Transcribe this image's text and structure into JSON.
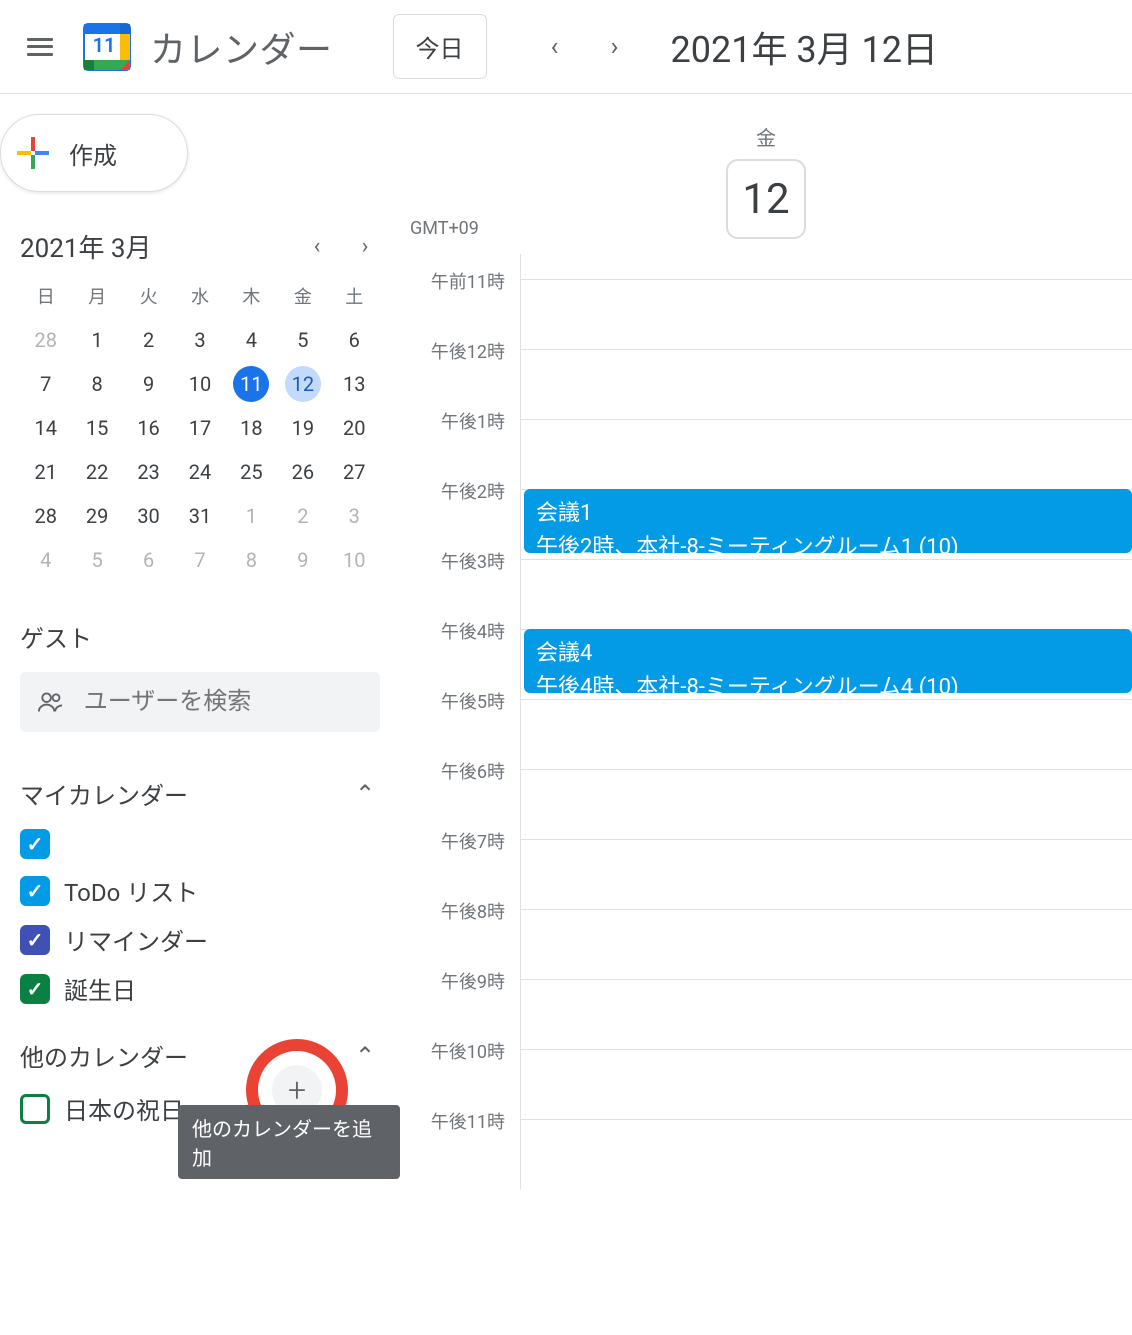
{
  "header": {
    "app_title": "カレンダー",
    "logo_number": "11",
    "today_label": "今日",
    "date_label": "2021年 3月 12日"
  },
  "create": {
    "label": "作成"
  },
  "minical": {
    "title": "2021年 3月",
    "dow": [
      "日",
      "月",
      "火",
      "水",
      "木",
      "金",
      "土"
    ],
    "weeks": [
      [
        {
          "d": "28",
          "off": true
        },
        {
          "d": "1"
        },
        {
          "d": "2"
        },
        {
          "d": "3"
        },
        {
          "d": "4"
        },
        {
          "d": "5"
        },
        {
          "d": "6"
        }
      ],
      [
        {
          "d": "7"
        },
        {
          "d": "8"
        },
        {
          "d": "9"
        },
        {
          "d": "10"
        },
        {
          "d": "11",
          "today": true
        },
        {
          "d": "12",
          "selected": true
        },
        {
          "d": "13"
        }
      ],
      [
        {
          "d": "14"
        },
        {
          "d": "15"
        },
        {
          "d": "16"
        },
        {
          "d": "17"
        },
        {
          "d": "18"
        },
        {
          "d": "19"
        },
        {
          "d": "20"
        }
      ],
      [
        {
          "d": "21"
        },
        {
          "d": "22"
        },
        {
          "d": "23"
        },
        {
          "d": "24"
        },
        {
          "d": "25"
        },
        {
          "d": "26"
        },
        {
          "d": "27"
        }
      ],
      [
        {
          "d": "28"
        },
        {
          "d": "29"
        },
        {
          "d": "30"
        },
        {
          "d": "31"
        },
        {
          "d": "1",
          "off": true
        },
        {
          "d": "2",
          "off": true
        },
        {
          "d": "3",
          "off": true
        }
      ],
      [
        {
          "d": "4",
          "off": true
        },
        {
          "d": "5",
          "off": true
        },
        {
          "d": "6",
          "off": true
        },
        {
          "d": "7",
          "off": true
        },
        {
          "d": "8",
          "off": true
        },
        {
          "d": "9",
          "off": true
        },
        {
          "d": "10",
          "off": true
        }
      ]
    ]
  },
  "guests": {
    "title": "ゲスト",
    "placeholder": "ユーザーを検索"
  },
  "my_calendars": {
    "title": "マイカレンダー",
    "items": [
      {
        "label": "",
        "color": "#039be5",
        "checked": true
      },
      {
        "label": "ToDo リスト",
        "color": "#039be5",
        "checked": true
      },
      {
        "label": "リマインダー",
        "color": "#3f51b5",
        "checked": true
      },
      {
        "label": "誕生日",
        "color": "#0b8043",
        "checked": true
      }
    ]
  },
  "other_calendars": {
    "title": "他のカレンダー",
    "tooltip": "他のカレンダーを追加",
    "items": [
      {
        "label": "日本の祝日",
        "color": "#0b8043",
        "checked": false
      }
    ]
  },
  "dayview": {
    "dow": "金",
    "day": "12",
    "tz": "GMT+09",
    "hours": [
      "午前11時",
      "午後12時",
      "午後1時",
      "午後2時",
      "午後3時",
      "午後4時",
      "午後5時",
      "午後6時",
      "午後7時",
      "午後8時",
      "午後9時",
      "午後10時",
      "午後11時"
    ],
    "events": [
      {
        "title": "会議1",
        "sub": "午後2時、本社-8-ミーティングルーム1 (10)",
        "start_idx": 3,
        "span": 1
      },
      {
        "title": "会議4",
        "sub": "午後4時、本社-8-ミーティングルーム4 (10)",
        "start_idx": 5,
        "span": 1
      }
    ]
  }
}
